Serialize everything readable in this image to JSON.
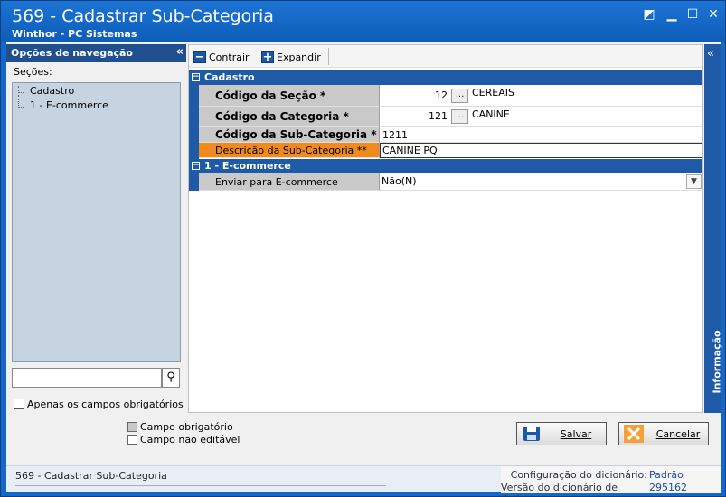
{
  "window": {
    "title": "569 - Cadastrar Sub-Categoria",
    "subtitle": "Winthor - PC Sistemas"
  },
  "nav": {
    "header": "Opções de navegação",
    "secoes_label": "Seções:",
    "tree": [
      {
        "label": "Cadastro"
      },
      {
        "label": "1 - E-commerce"
      }
    ],
    "search_placeholder": "",
    "only_required_label": "Apenas os campos obrigatórios"
  },
  "toolbar": {
    "collapse_label": "Contrair",
    "expand_label": "Expandir"
  },
  "grid": {
    "cadastro_header": "Cadastro",
    "ecommerce_header": "1 - E-commerce",
    "fields": {
      "secao": {
        "label": "Código da Seção *",
        "code": "12",
        "desc": "CEREAIS"
      },
      "categoria": {
        "label": "Código da Categoria *",
        "code": "121",
        "desc": "CANINE"
      },
      "subcategoria": {
        "label": "Código da Sub-Categoria *",
        "value": "1211"
      },
      "descricao": {
        "label": "Descrição da Sub-Categoria **",
        "value": "CANINE PQ"
      },
      "enviar": {
        "label": "Enviar para E-commerce",
        "value": "Não(N)"
      }
    },
    "ellipsis": "..."
  },
  "info_panel": {
    "label": "Informação"
  },
  "legend": {
    "required": "Campo obrigatório",
    "not_editable": "Campo não editável"
  },
  "actions": {
    "save": "Salvar",
    "cancel": "Cancelar"
  },
  "status": {
    "left": "569 - Cadastrar Sub-Categoria",
    "config_label": "Configuração do dicionário:",
    "config_value": "Padrão",
    "version_label": "Versão do dicionário de dados:",
    "version_value": "295162"
  },
  "colors": {
    "title_blue": "#1568c7",
    "category_blue": "#1f5aa6",
    "required_orange": "#f08a1c",
    "cancel_orange": "#f5a03a"
  }
}
